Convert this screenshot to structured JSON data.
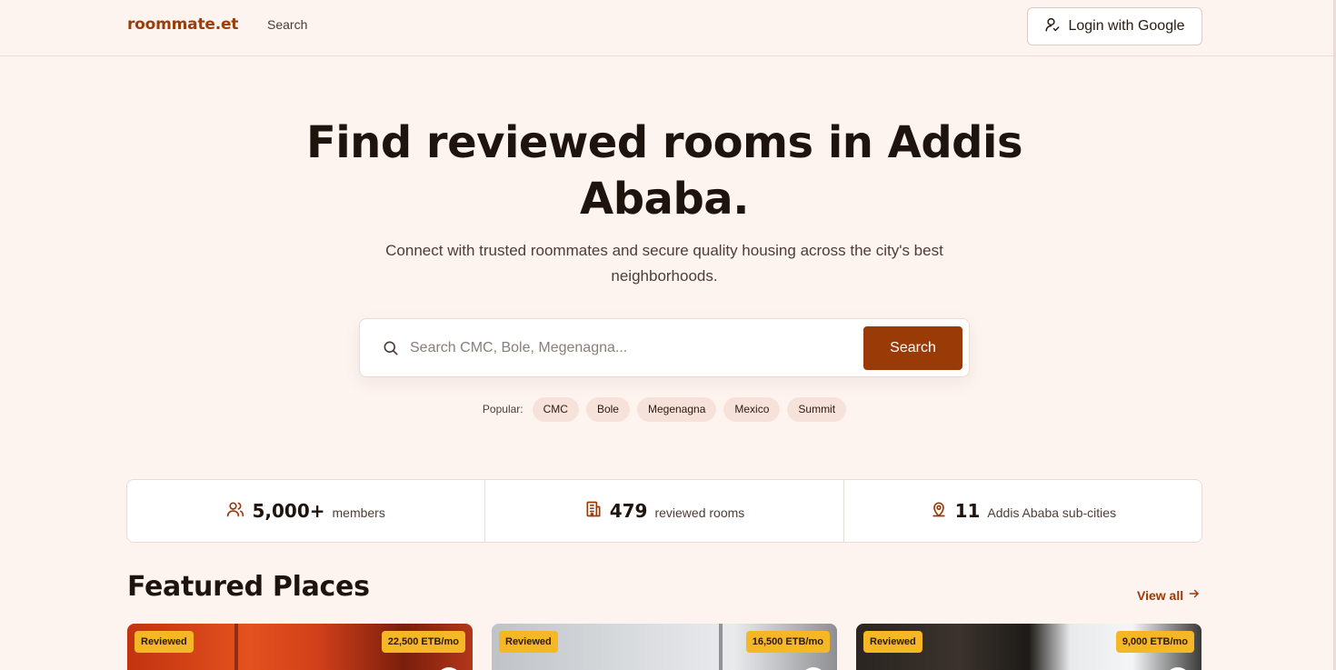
{
  "header": {
    "brand": "roommate.et",
    "nav_search": "Search",
    "login_label": "Login with Google"
  },
  "hero": {
    "title": "Find reviewed rooms in Addis Ababa.",
    "subtitle": "Connect with trusted roommates and secure quality housing across the city's best neighborhoods."
  },
  "search": {
    "placeholder": "Search CMC, Bole, Megenagna...",
    "value": "",
    "button_label": "Search"
  },
  "popular": {
    "label": "Popular:",
    "tags": [
      "CMC",
      "Bole",
      "Megenagna",
      "Mexico",
      "Summit"
    ]
  },
  "stats": [
    {
      "value": "5,000+",
      "label": "members",
      "icon": "users-icon"
    },
    {
      "value": "479",
      "label": "reviewed rooms",
      "icon": "building-icon"
    },
    {
      "value": "11",
      "label": "Addis Ababa sub-cities",
      "icon": "map-pin-icon"
    }
  ],
  "featured": {
    "title": "Featured Places",
    "view_all": "View all",
    "cards": [
      {
        "badge": "Reviewed",
        "price": "22,500 ETB/mo"
      },
      {
        "badge": "Reviewed",
        "price": "16,500 ETB/mo"
      },
      {
        "badge": "Reviewed",
        "price": "9,000 ETB/mo"
      }
    ]
  },
  "colors": {
    "accent": "#9a3a06",
    "background": "#fdf4f0",
    "badge": "#f6b726"
  }
}
